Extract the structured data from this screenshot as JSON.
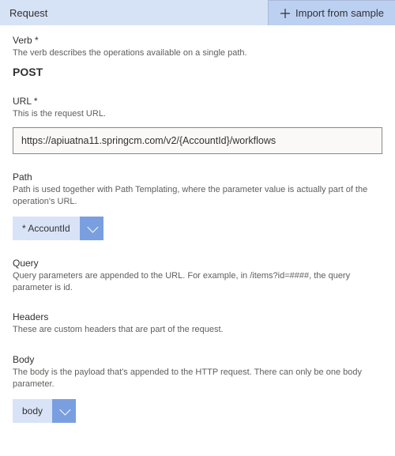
{
  "header": {
    "title": "Request",
    "import_label": "Import from sample"
  },
  "verb": {
    "label": "Verb *",
    "desc": "The verb describes the operations available on a single path.",
    "value": "POST"
  },
  "url": {
    "label": "URL *",
    "desc": "This is the request URL.",
    "value": "https://apiuatna11.springcm.com/v2/{AccountId}/workflows"
  },
  "path": {
    "label": "Path",
    "desc": "Path is used together with Path Templating, where the parameter value is actually part of the operation's URL.",
    "chip": "* AccountId"
  },
  "query": {
    "label": "Query",
    "desc": "Query parameters are appended to the URL. For example, in /items?id=####, the query parameter is id."
  },
  "headers": {
    "label": "Headers",
    "desc": "These are custom headers that are part of the request."
  },
  "body": {
    "label": "Body",
    "desc": "The body is the payload that's appended to the HTTP request. There can only be one body parameter.",
    "chip": "body"
  }
}
